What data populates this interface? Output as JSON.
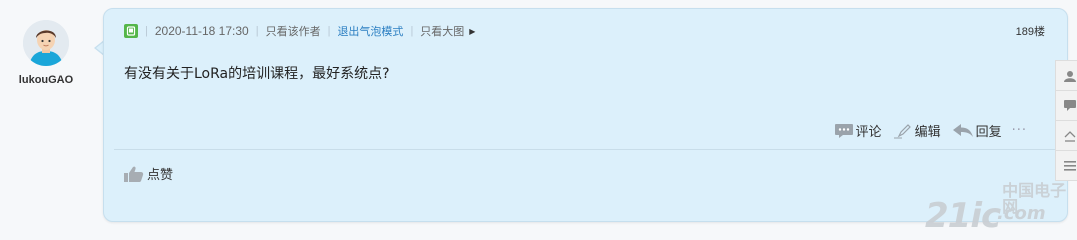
{
  "author": {
    "name": "lukouGAO",
    "avatar_icon": "user-avatar-icon"
  },
  "post": {
    "meta": {
      "device_icon": "tablet-icon",
      "datetime": "2020-11-18 17:30",
      "only_author": "只看该作者",
      "exit_bubble_mode": "退出气泡模式",
      "large_image": "只看大图",
      "floor": "189楼"
    },
    "content": "有没有关于LoRa的培训课程，最好系统点?",
    "actions": {
      "comment": "评论",
      "edit": "编辑",
      "reply": "回复",
      "more": "···"
    },
    "like_label": "点赞"
  },
  "watermark": {
    "brand_big": "21ic",
    "brand_small": "中国电子网",
    "brand_tail": ".com"
  },
  "side_tools": [
    "profile-icon",
    "comment-icon",
    "top-icon",
    "list-icon"
  ],
  "colors": {
    "bubble_bg": "#dcf0fb",
    "link_blue": "#2c7fc2",
    "device_green": "#55b64a"
  }
}
